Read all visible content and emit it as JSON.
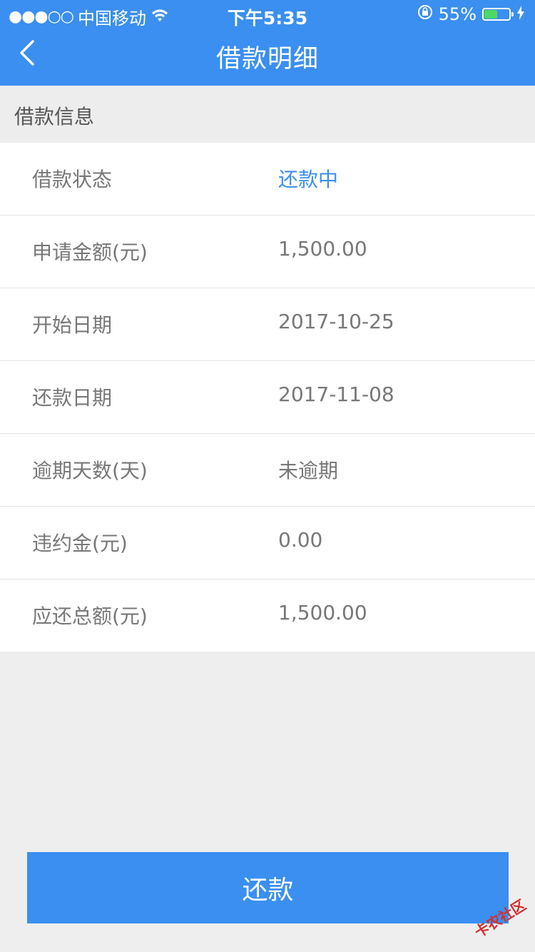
{
  "status_bar": {
    "signal_dots": "●●●○○",
    "carrier": "中国移动",
    "time": "下午5:35",
    "battery_percent": "55%",
    "battery_level": 0.55
  },
  "header": {
    "title": "借款明细"
  },
  "section": {
    "title": "借款信息"
  },
  "rows": [
    {
      "label": "借款状态",
      "value": "还款中"
    },
    {
      "label": "申请金额(元)",
      "value": "1,500.00"
    },
    {
      "label": "开始日期",
      "value": "2017-10-25"
    },
    {
      "label": "还款日期",
      "value": "2017-11-08"
    },
    {
      "label": "逾期天数(天)",
      "value": "未逾期"
    },
    {
      "label": "违约金(元)",
      "value": "0.00"
    },
    {
      "label": "应还总额(元)",
      "value": "1,500.00"
    }
  ],
  "actions": {
    "repay_label": "还款"
  },
  "watermark": {
    "text": "卡农社区"
  },
  "colors": {
    "primary": "#3a8ff0",
    "battery": "#4cd964"
  }
}
